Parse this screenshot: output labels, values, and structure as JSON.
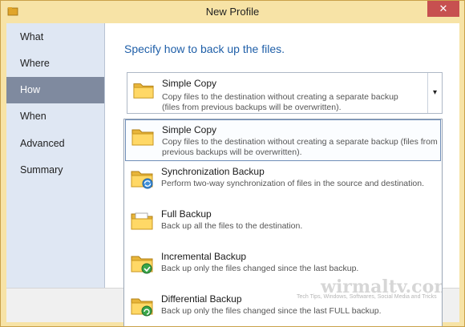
{
  "window": {
    "title": "New Profile",
    "close_label": "✕"
  },
  "sidebar": {
    "items": [
      {
        "label": "What"
      },
      {
        "label": "Where"
      },
      {
        "label": "How"
      },
      {
        "label": "When"
      },
      {
        "label": "Advanced"
      },
      {
        "label": "Summary"
      }
    ],
    "active": "How"
  },
  "main": {
    "heading": "Specify how to back up the files."
  },
  "combo": {
    "selected_title": "Simple Copy",
    "selected_desc": "Copy files to the destination without creating a separate backup (files from previous backups will be overwritten).",
    "dropdown_arrow": "▾"
  },
  "options": [
    {
      "title": "Simple Copy",
      "desc": "Copy files to the destination without creating a separate backup (files from previous backups will be overwritten).",
      "icon": "folder-icon"
    },
    {
      "title": "Synchronization Backup",
      "desc": "Perform two-way synchronization of files in the source and destination.",
      "icon": "folder-sync-icon"
    },
    {
      "title": "Full Backup",
      "desc": "Back up all the files to the destination.",
      "icon": "folder-documents-icon"
    },
    {
      "title": "Incremental Backup",
      "desc": "Back up only the files changed since the last backup.",
      "icon": "folder-incremental-icon"
    },
    {
      "title": "Differential Backup",
      "desc": "Back up only the files changed since the last FULL backup.",
      "icon": "folder-differential-icon"
    }
  ],
  "watermark": {
    "text": "wirmaltv.com",
    "tagline": "Tech Tips, Windows, Softwares, Social Media and Tricks"
  },
  "colors": {
    "accent": "#1f5fa8",
    "sidebar_bg": "#dfe7f3",
    "sidebar_active": "#7f8a9f",
    "title_bar": "#f7e3a6",
    "close_button": "#c75050"
  }
}
